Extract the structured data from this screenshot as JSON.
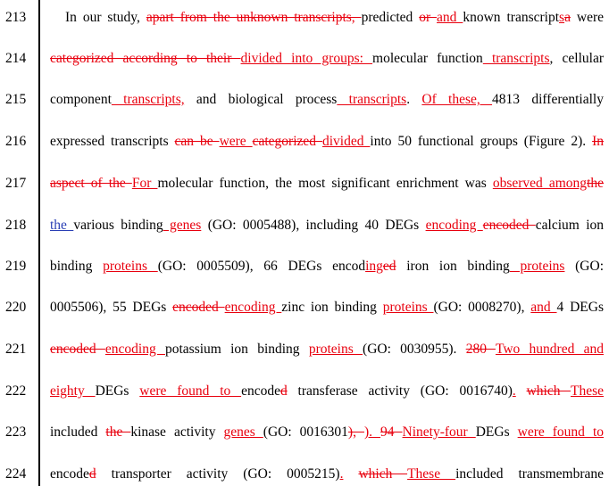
{
  "document": {
    "lines": [
      {
        "number": "213",
        "segments": [
          {
            "t": "In our study, ",
            "k": "norm"
          },
          {
            "t": "apart from the unknown transcripts, ",
            "k": "del"
          },
          {
            "t": "predicted ",
            "k": "norm"
          },
          {
            "t": "or ",
            "k": "del"
          },
          {
            "t": "and ",
            "k": "ins"
          },
          {
            "t": "known transcript",
            "k": "norm"
          },
          {
            "t": "s",
            "k": "ins"
          },
          {
            "t": "a",
            "k": "del"
          },
          {
            "t": " were",
            "k": "norm"
          }
        ]
      },
      {
        "number": "214",
        "segments": [
          {
            "t": "categorized according to their ",
            "k": "del"
          },
          {
            "t": "divided into groups: ",
            "k": "ins"
          },
          {
            "t": "molecular function",
            "k": "norm"
          },
          {
            "t": " transcripts",
            "k": "ins"
          },
          {
            "t": ", cellular",
            "k": "norm"
          }
        ]
      },
      {
        "number": "215",
        "segments": [
          {
            "t": "component",
            "k": "norm"
          },
          {
            "t": " transcripts,",
            "k": "ins"
          },
          {
            "t": " and biological process",
            "k": "norm"
          },
          {
            "t": " transcripts",
            "k": "ins"
          },
          {
            "t": ". ",
            "k": "norm"
          },
          {
            "t": "Of these, ",
            "k": "ins"
          },
          {
            "t": "4813 differentially",
            "k": "norm"
          }
        ]
      },
      {
        "number": "216",
        "segments": [
          {
            "t": "expressed transcripts ",
            "k": "norm"
          },
          {
            "t": "can be ",
            "k": "del"
          },
          {
            "t": "were ",
            "k": "ins"
          },
          {
            "t": "categorized ",
            "k": "del"
          },
          {
            "t": "divided ",
            "k": "ins"
          },
          {
            "t": "into 50 functional groups (Figure 2). ",
            "k": "norm"
          },
          {
            "t": "In",
            "k": "del"
          }
        ]
      },
      {
        "number": "217",
        "segments": [
          {
            "t": "aspect of the ",
            "k": "del"
          },
          {
            "t": "For ",
            "k": "ins"
          },
          {
            "t": "molecular function, the most significant enrichment was ",
            "k": "norm"
          },
          {
            "t": "observed among",
            "k": "ins"
          },
          {
            "t": "the",
            "k": "del"
          }
        ]
      },
      {
        "number": "218",
        "segments": [
          {
            "t": "the ",
            "k": "insb"
          },
          {
            "t": "various binding",
            "k": "norm"
          },
          {
            "t": " genes",
            "k": "ins"
          },
          {
            "t": " (GO: 0005488), including 40 DEGs ",
            "k": "norm"
          },
          {
            "t": "encoding ",
            "k": "ins"
          },
          {
            "t": "encoded ",
            "k": "del"
          },
          {
            "t": "calcium ion",
            "k": "norm"
          }
        ]
      },
      {
        "number": "219",
        "segments": [
          {
            "t": "binding ",
            "k": "norm"
          },
          {
            "t": "proteins ",
            "k": "ins"
          },
          {
            "t": "(GO: 0005509), 66 DEGs encod",
            "k": "norm"
          },
          {
            "t": "ing",
            "k": "ins"
          },
          {
            "t": "ed",
            "k": "del"
          },
          {
            "t": " iron ion binding",
            "k": "norm"
          },
          {
            "t": " proteins",
            "k": "ins"
          },
          {
            "t": " (GO:",
            "k": "norm"
          }
        ]
      },
      {
        "number": "220",
        "segments": [
          {
            "t": "0005506), 55 DEGs ",
            "k": "norm"
          },
          {
            "t": "encoded ",
            "k": "del"
          },
          {
            "t": "encoding ",
            "k": "ins"
          },
          {
            "t": "zinc ion binding ",
            "k": "norm"
          },
          {
            "t": "proteins ",
            "k": "ins"
          },
          {
            "t": "(GO: 0008270), ",
            "k": "norm"
          },
          {
            "t": "and ",
            "k": "ins"
          },
          {
            "t": "4 DEGs",
            "k": "norm"
          }
        ]
      },
      {
        "number": "221",
        "segments": [
          {
            "t": "encoded ",
            "k": "del"
          },
          {
            "t": "encoding ",
            "k": "ins"
          },
          {
            "t": "potassium ion binding ",
            "k": "norm"
          },
          {
            "t": "proteins ",
            "k": "ins"
          },
          {
            "t": "(GO: 0030955). ",
            "k": "norm"
          },
          {
            "t": "280 ",
            "k": "del"
          },
          {
            "t": "Two hundred and",
            "k": "ins"
          }
        ]
      },
      {
        "number": "222",
        "segments": [
          {
            "t": "eighty ",
            "k": "ins"
          },
          {
            "t": "DEGs ",
            "k": "norm"
          },
          {
            "t": "were found to ",
            "k": "ins"
          },
          {
            "t": "encode",
            "k": "norm"
          },
          {
            "t": "d",
            "k": "del"
          },
          {
            "t": " transferase activity (GO: 0016740)",
            "k": "norm"
          },
          {
            "t": ".",
            "k": "ins"
          },
          {
            "t": " ",
            "k": "norm"
          },
          {
            "t": "which ",
            "k": "del"
          },
          {
            "t": "These",
            "k": "ins"
          }
        ]
      },
      {
        "number": "223",
        "segments": [
          {
            "t": "included ",
            "k": "norm"
          },
          {
            "t": "the ",
            "k": "del"
          },
          {
            "t": "kinase activity ",
            "k": "norm"
          },
          {
            "t": "genes ",
            "k": "ins"
          },
          {
            "t": "(GO: 0016301",
            "k": "norm"
          },
          {
            "t": "), ",
            "k": "del"
          },
          {
            "t": "). ",
            "k": "ins"
          },
          {
            "t": "94 ",
            "k": "del"
          },
          {
            "t": "Ninety-four ",
            "k": "ins"
          },
          {
            "t": "DEGs ",
            "k": "norm"
          },
          {
            "t": "were found to",
            "k": "ins"
          }
        ]
      },
      {
        "number": "224",
        "segments": [
          {
            "t": "encode",
            "k": "norm"
          },
          {
            "t": "d",
            "k": "del"
          },
          {
            "t": " transporter activity (GO: 0005215)",
            "k": "norm"
          },
          {
            "t": ".",
            "k": "ins"
          },
          {
            "t": " ",
            "k": "norm"
          },
          {
            "t": "which ",
            "k": "del"
          },
          {
            "t": "These ",
            "k": "ins"
          },
          {
            "t": "included transmembrane",
            "k": "norm"
          }
        ]
      }
    ]
  },
  "colors": {
    "insertion": "#e8000e",
    "deletion": "#e8000e",
    "insertion_alt_author": "#2a3fb5",
    "text": "#000000"
  }
}
